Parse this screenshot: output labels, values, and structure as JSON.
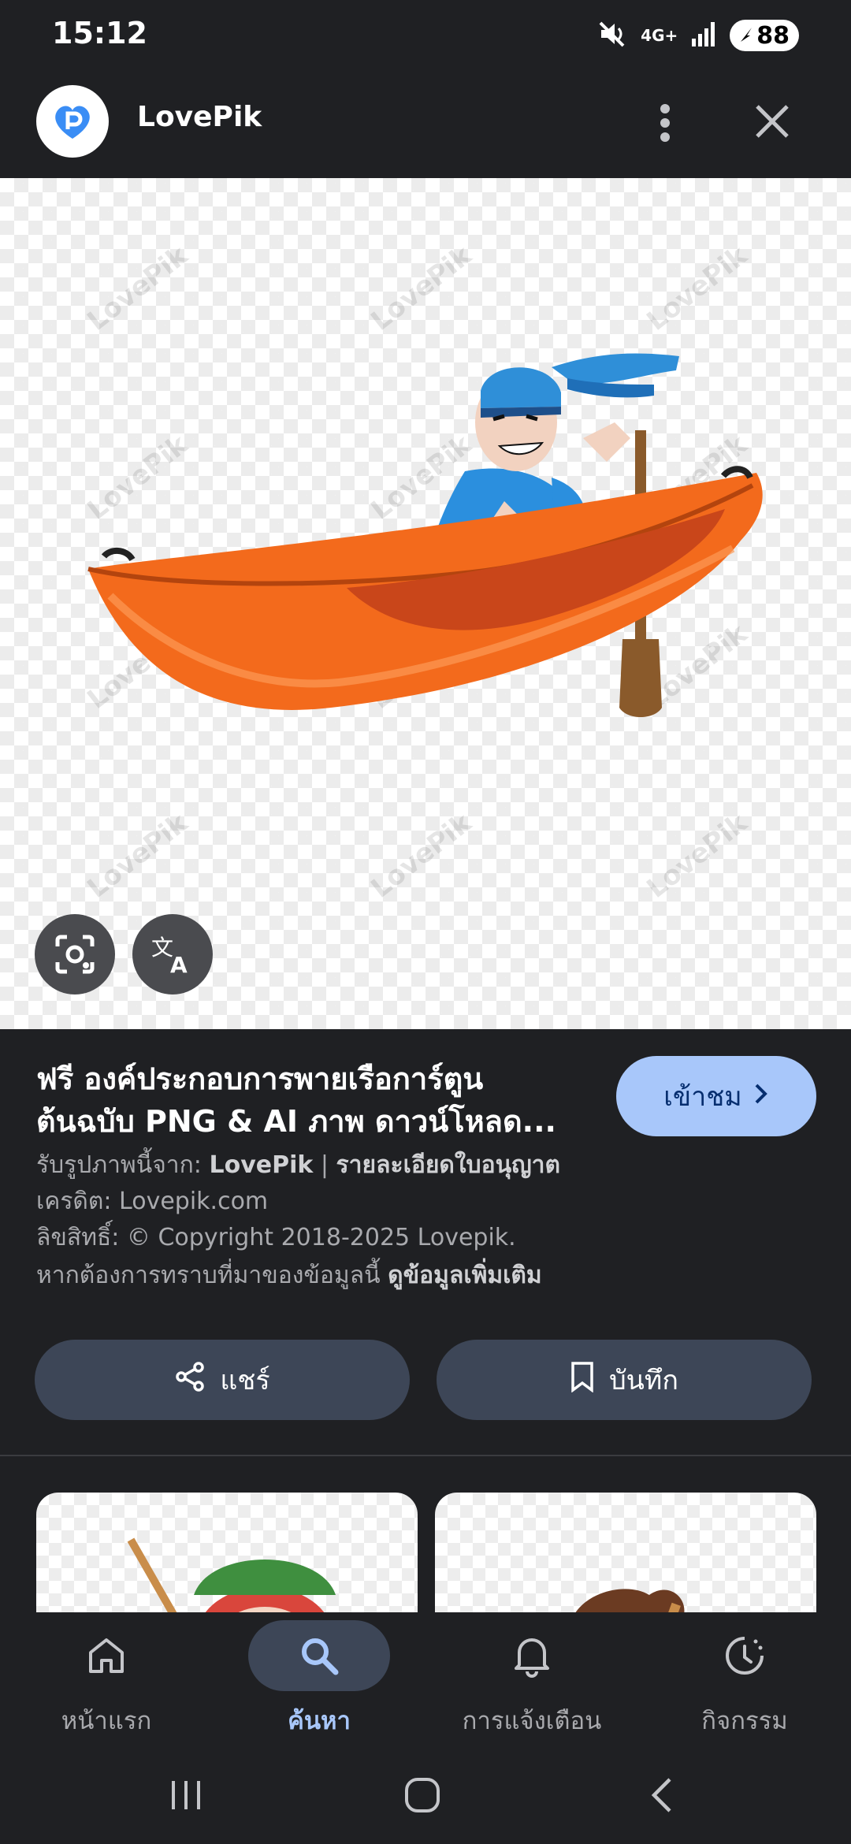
{
  "status_bar": {
    "time": "15:12",
    "network": "4G+",
    "battery": "88"
  },
  "header": {
    "site_name": "LovePik",
    "logo_icon": "lovepik-logo-icon",
    "more_icon": "more-vert-icon",
    "close_icon": "close-icon"
  },
  "image": {
    "watermark": "LovePik",
    "description_icons": [
      "google-lens-icon",
      "translate-icon"
    ]
  },
  "info": {
    "title": "ฟรี องค์ประกอบการพายเรือการ์ตูน ต้นฉบับ PNG & AI ภาพ ดาวน์โหลด...",
    "visit_label": "เข้าชม",
    "source_prefix": "รับรูปภาพนี้จาก:",
    "source_name": "LovePik",
    "source_sep": "|",
    "license_link": "รายละเอียดใบอนุญาต",
    "credit": "เครดิต: Lovepik.com",
    "copyright": "ลิขสิทธิ์: © Copyright 2018-2025 Lovepik.",
    "more_prefix": "หากต้องการทราบที่มาของข้อมูลนี้",
    "more_link": "ดูข้อมูลเพิ่มเติม",
    "share_label": "แชร์",
    "save_label": "บันทึก"
  },
  "bottom_nav": {
    "items": [
      {
        "label": "หน้าแรก",
        "icon": "home-icon"
      },
      {
        "label": "ค้นหา",
        "icon": "search-icon",
        "active": true
      },
      {
        "label": "การแจ้งเตือน",
        "icon": "bell-icon"
      },
      {
        "label": "กิจกรรม",
        "icon": "activity-icon"
      }
    ]
  },
  "colors": {
    "background": "#1f2023",
    "accent": "#a8c7fa",
    "button_bg": "#3d4657"
  }
}
